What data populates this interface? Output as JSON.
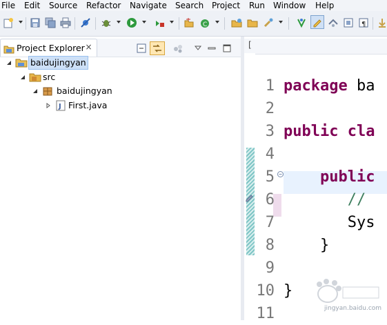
{
  "menu": [
    "File",
    "Edit",
    "Source",
    "Refactor",
    "Navigate",
    "Search",
    "Project",
    "Run",
    "Window",
    "Help"
  ],
  "toolbar_icons": [
    "new-icon",
    "save-icon",
    "save-all-icon",
    "print-icon",
    "skip-breakpoints-icon",
    "debug-icon",
    "run-icon",
    "external-tools-icon",
    "new-java-project-icon",
    "new-class-icon",
    "open-type-icon",
    "open-task-icon",
    "search-icon",
    "toggle-mark-occurrences-icon",
    "highlight-icon",
    "annotation-icon",
    "block-selection-icon",
    "show-whitespace-icon",
    "next-annotation-icon"
  ],
  "explorer": {
    "title": "Project Explorer",
    "close_symbol": "×",
    "tree": [
      {
        "label": "baidujingyan",
        "icon": "project-folder-icon",
        "expanded": true,
        "selected": true
      },
      {
        "label": "src",
        "icon": "source-folder-icon",
        "expanded": true
      },
      {
        "label": "baidujingyan",
        "icon": "package-icon",
        "expanded": true
      },
      {
        "label": "First.java",
        "icon": "java-file-icon",
        "expanded": false
      }
    ]
  },
  "editor": {
    "tab_fragment": "[",
    "line_numbers": [
      "1",
      "2",
      "3",
      "4",
      "5",
      "6",
      "7",
      "8",
      "9",
      "10",
      "11"
    ],
    "lines": [
      {
        "kw": "package",
        "rest": " ba"
      },
      {
        "kw": "",
        "rest": ""
      },
      {
        "kw": "public",
        "rest": " ",
        "kw2": "cla"
      },
      {
        "kw": "",
        "rest": ""
      },
      {
        "indent": "    ",
        "kw": "public",
        "rest": ""
      },
      {
        "indent": "       ",
        "comment": "//"
      },
      {
        "indent": "       ",
        "rest": "Sys"
      },
      {
        "indent": "    ",
        "rest": "}"
      },
      {
        "rest": ""
      },
      {
        "rest": "}"
      },
      {
        "rest": ""
      }
    ]
  },
  "colors": {
    "keyword": "#7f0055",
    "comment": "#3f7f5f",
    "current_line": "#e8f2fe"
  },
  "watermark": {
    "text": "jingyan.baidu.com"
  }
}
